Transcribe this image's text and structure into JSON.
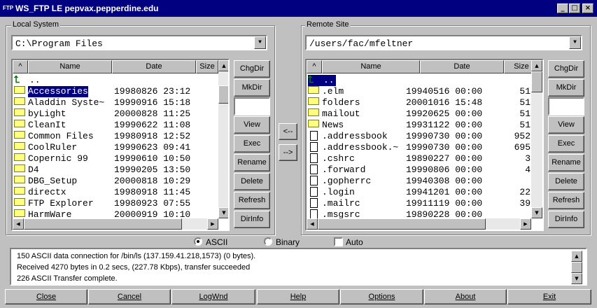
{
  "window": {
    "title": "WS_FTP LE pepvax.pepperdine.edu",
    "icon_text": "FTP",
    "controls": [
      "_",
      "□",
      "×"
    ]
  },
  "local": {
    "label": "Local System",
    "path": "C:\\Program Files",
    "columns": {
      "name": "Name",
      "date": "Date",
      "size": "Size"
    },
    "sort_caret": "^",
    "up_item": "..",
    "items": [
      {
        "name": "Accessories",
        "date": "19980826 23:12"
      },
      {
        "name": "Aladdin Syste~",
        "date": "19990916 15:18"
      },
      {
        "name": "byLight",
        "date": "20000828 11:25"
      },
      {
        "name": "CleanIt",
        "date": "19990622 11:08"
      },
      {
        "name": "Common Files",
        "date": "19980918 12:52"
      },
      {
        "name": "CoolRuler",
        "date": "19990623 09:41"
      },
      {
        "name": "Copernic 99",
        "date": "19990610 10:50"
      },
      {
        "name": "D4",
        "date": "19990205 13:50"
      },
      {
        "name": "DBG_Setup",
        "date": "20000818 10:29"
      },
      {
        "name": "directx",
        "date": "19980918 11:45"
      },
      {
        "name": "FTP Explorer",
        "date": "19980923 07:55"
      },
      {
        "name": "HarmWare",
        "date": "20000919 10:10"
      }
    ],
    "buttons": [
      "ChgDir",
      "MkDir",
      "View",
      "Exec",
      "Rename",
      "Delete",
      "Refresh",
      "DirInfo"
    ]
  },
  "remote": {
    "label": "Remote Site",
    "path": "/users/fac/mfeltner",
    "columns": {
      "name": "Name",
      "date": "Date",
      "size": "Size"
    },
    "sort_caret": "^",
    "up_item": "..",
    "items": [
      {
        "name": ".elm",
        "date": "19940516 00:00",
        "size": "51",
        "type": "folder"
      },
      {
        "name": "folders",
        "date": "20001016 15:48",
        "size": "51",
        "type": "folder"
      },
      {
        "name": "mailout",
        "date": "19920625 00:00",
        "size": "51",
        "type": "folder"
      },
      {
        "name": "News",
        "date": "19931122 00:00",
        "size": "51",
        "type": "folder"
      },
      {
        "name": ".addressbook",
        "date": "19990730 00:00",
        "size": "952",
        "type": "file"
      },
      {
        "name": ".addressbook.~",
        "date": "19990730 00:00",
        "size": "695",
        "type": "file"
      },
      {
        "name": ".cshrc",
        "date": "19890227 00:00",
        "size": "3",
        "type": "file"
      },
      {
        "name": ".forward",
        "date": "19990806 00:00",
        "size": "4",
        "type": "file"
      },
      {
        "name": ".gopherrc",
        "date": "19940308 00:00",
        "size": "",
        "type": "file"
      },
      {
        "name": ".login",
        "date": "19941201 00:00",
        "size": "22",
        "type": "file"
      },
      {
        "name": ".mailrc",
        "date": "19911119 00:00",
        "size": "39",
        "type": "file"
      },
      {
        "name": ".msgsrc",
        "date": "19890228 00:00",
        "size": "",
        "type": "file"
      }
    ],
    "buttons": [
      "ChgDir",
      "MkDir",
      "View",
      "Exec",
      "Rename",
      "Delete",
      "Refresh",
      "DirInfo"
    ]
  },
  "transfer": {
    "left": "<--",
    "right": "-->"
  },
  "mode": {
    "ascii": "ASCII",
    "binary": "Binary",
    "auto": "Auto",
    "selected": "ASCII",
    "auto_checked": false
  },
  "log": [
    "150 ASCII data connection for /bin/ls (137.159.41.218,1573) (0 bytes).",
    "Received 4270 bytes in 0.2 secs, (227.78 Kbps), transfer succeeded",
    "226 ASCII Transfer complete."
  ],
  "bottom_buttons": [
    "Close",
    "Cancel",
    "LogWnd",
    "Help",
    "Options",
    "About",
    "Exit"
  ]
}
